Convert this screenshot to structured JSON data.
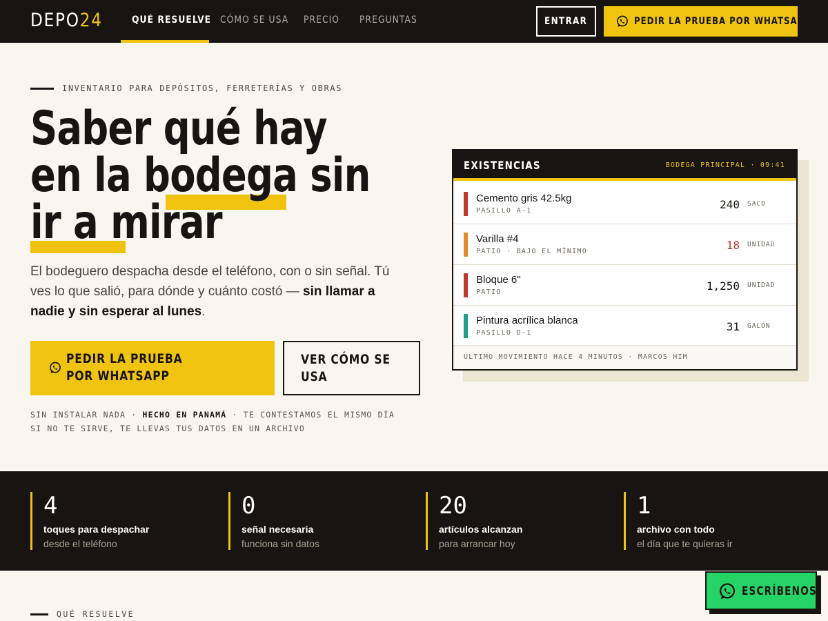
{
  "brand": {
    "name": "DEPO",
    "accent": "24"
  },
  "nav": {
    "links": [
      "QUÉ RESUELVE",
      "CÓMO SE USA",
      "PRECIO",
      "PREGUNTAS"
    ],
    "active": "QUÉ RESUELVE",
    "login": "ENTRAR",
    "whatsapp_cta": "PEDIR LA PRUEBA POR WHATSAPP"
  },
  "hero": {
    "eyebrow": "INVENTARIO PARA DEPÓSITOS, FERRETERÍAS Y OBRAS",
    "headline": {
      "part1": "Saber qué hay en la bodega ",
      "highlight1": "sin ir a",
      "part2": " ",
      "highlight2": "mirar"
    },
    "lede": {
      "text": "El bodeguero despacha desde el teléfono, con o sin señal. Tú ves lo que salió, para dónde y cuánto costó — ",
      "bold": "sin llamar a nadie y sin esperar al lunes",
      "end": "."
    },
    "cta_primary": "PEDIR LA PRUEBA POR WHATSAPP",
    "cta_secondary": "VER CÓMO SE USA",
    "fine_print": {
      "line1_a": "SIN INSTALAR NADA · ",
      "line1_b": "HECHO EN PANAMÁ",
      "line1_c": " · TE CONTESTAMOS EL MISMO DÍA",
      "line2": "SI NO TE SIRVE, TE LLEVAS TUS DATOS EN UN ARCHIVO"
    }
  },
  "stock_card": {
    "title": "EXISTENCIAS",
    "meta": "BODEGA PRINCIPAL · 09:41",
    "items": [
      {
        "name": "Cemento gris 42.5kg",
        "location": "PASILLO A-1",
        "qty": "240",
        "unit": "SACO",
        "status_color": "#c0392b",
        "low": false
      },
      {
        "name": "Varilla #4",
        "location": "PATIO · BAJO EL MÍNIMO",
        "qty": "18",
        "unit": "UNIDAD",
        "status_color": "#e08a2c",
        "low": true
      },
      {
        "name": "Bloque 6\"",
        "location": "PATIO",
        "qty": "1,250",
        "unit": "UNIDAD",
        "status_color": "#c0392b",
        "low": false
      },
      {
        "name": "Pintura acrílica blanca",
        "location": "PASILLO D-1",
        "qty": "31",
        "unit": "GALÓN",
        "status_color": "#1fa08a",
        "low": false
      }
    ],
    "footer": "ÚLTIMO MOVIMIENTO HACE 4 MINUTOS · MARCOS HIM"
  },
  "stats": [
    {
      "num": "4",
      "label": "toques para despachar",
      "sub": "desde el teléfono"
    },
    {
      "num": "0",
      "label": "señal necesaria",
      "sub": "funciona sin datos"
    },
    {
      "num": "20",
      "label": "artículos alcanzan",
      "sub": "para arrancar hoy"
    },
    {
      "num": "1",
      "label": "archivo con todo",
      "sub": "el día que te quieras ir"
    }
  ],
  "next_section": {
    "label": "QUÉ RESUELVE"
  },
  "floating_cta": "ESCRÍBENOS",
  "colors": {
    "accent": "#f0c30f",
    "dark": "#171411",
    "background": "#f9f6ef",
    "whatsapp": "#25d366",
    "alert": "#c0392b"
  },
  "icons": {
    "whatsapp": "whatsapp-icon"
  }
}
